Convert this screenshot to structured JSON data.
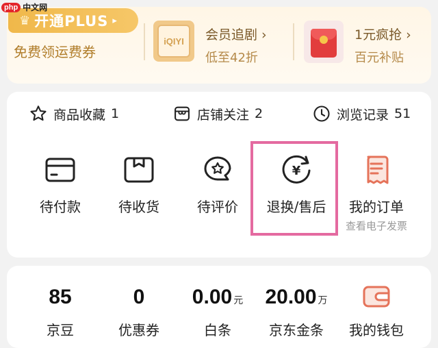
{
  "watermark": {
    "logo": "php",
    "text": "中文网"
  },
  "promo": {
    "plus_label": "开通PLUS",
    "plus_arrow": "▸",
    "plus_sub": "免费领运费券",
    "vip": {
      "logo": "iQIYI",
      "title": "会员追剧 ›",
      "subtitle": "低至42折"
    },
    "cash": {
      "title": "1元疯抢 ›",
      "subtitle": "百元补贴"
    }
  },
  "quick_links": [
    {
      "label": "商品收藏",
      "count": "1",
      "icon": "star-icon"
    },
    {
      "label": "店铺关注",
      "count": "2",
      "icon": "shop-icon"
    },
    {
      "label": "浏览记录",
      "count": "51",
      "icon": "clock-icon"
    }
  ],
  "orders": [
    {
      "label": "待付款",
      "icon": "card-icon"
    },
    {
      "label": "待收货",
      "icon": "package-icon"
    },
    {
      "label": "待评价",
      "icon": "review-bubble-icon"
    },
    {
      "label": "退换/售后",
      "icon": "refund-icon",
      "highlighted": true
    },
    {
      "label": "我的订单",
      "sub": "查看电子发票",
      "icon": "receipt-icon"
    }
  ],
  "assets": [
    {
      "value": "85",
      "unit": "",
      "label": "京豆"
    },
    {
      "value": "0",
      "unit": "",
      "label": "优惠券"
    },
    {
      "value": "0.00",
      "unit": "元",
      "label": "白条"
    },
    {
      "value": "20.00",
      "unit": "万",
      "label": "京东金条"
    },
    {
      "value": "",
      "unit": "",
      "label": "我的钱包",
      "icon": "wallet-icon"
    }
  ],
  "colors": {
    "accent_gold": "#f0b84a",
    "highlight_pink": "#e46aa0",
    "icon_orange": "#e5735a"
  }
}
